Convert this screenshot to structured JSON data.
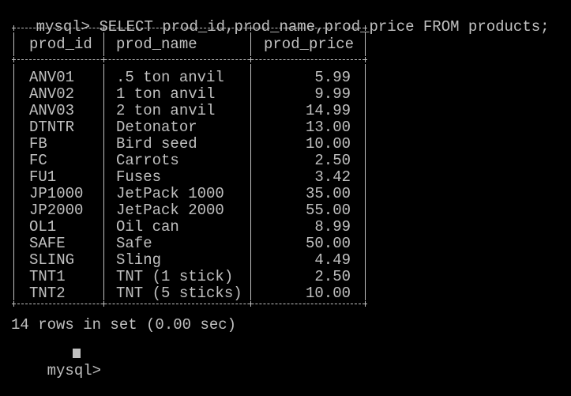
{
  "terminal": {
    "prompt": "mysql>",
    "command": "SELECT prod_id,prod_name,prod_price FROM products;",
    "columns": [
      "prod_id",
      "prod_name",
      "prod_price"
    ],
    "rows": [
      {
        "prod_id": "ANV01",
        "prod_name": ".5 ton anvil",
        "prod_price": "5.99"
      },
      {
        "prod_id": "ANV02",
        "prod_name": "1 ton anvil",
        "prod_price": "9.99"
      },
      {
        "prod_id": "ANV03",
        "prod_name": "2 ton anvil",
        "prod_price": "14.99"
      },
      {
        "prod_id": "DTNTR",
        "prod_name": "Detonator",
        "prod_price": "13.00"
      },
      {
        "prod_id": "FB",
        "prod_name": "Bird seed",
        "prod_price": "10.00"
      },
      {
        "prod_id": "FC",
        "prod_name": "Carrots",
        "prod_price": "2.50"
      },
      {
        "prod_id": "FU1",
        "prod_name": "Fuses",
        "prod_price": "3.42"
      },
      {
        "prod_id": "JP1000",
        "prod_name": "JetPack 1000",
        "prod_price": "35.00"
      },
      {
        "prod_id": "JP2000",
        "prod_name": "JetPack 2000",
        "prod_price": "55.00"
      },
      {
        "prod_id": "OL1",
        "prod_name": "Oil can",
        "prod_price": "8.99"
      },
      {
        "prod_id": "SAFE",
        "prod_name": "Safe",
        "prod_price": "50.00"
      },
      {
        "prod_id": "SLING",
        "prod_name": "Sling",
        "prod_price": "4.49"
      },
      {
        "prod_id": "TNT1",
        "prod_name": "TNT (1 stick)",
        "prod_price": "2.50"
      },
      {
        "prod_id": "TNT2",
        "prod_name": "TNT (5 sticks)",
        "prod_price": "10.00"
      }
    ],
    "status": "14 rows in set (0.00 sec)",
    "next_prompt": "mysql>"
  },
  "colors": {
    "background": "#000000",
    "foreground": "#c0c0c0"
  }
}
